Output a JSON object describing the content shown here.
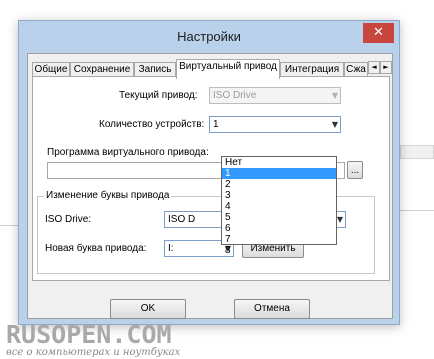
{
  "window": {
    "title": "Настройки",
    "close_glyph": "✕"
  },
  "tabs": [
    {
      "label": "Общие",
      "active": false
    },
    {
      "label": "Сохранение",
      "active": false
    },
    {
      "label": "Запись",
      "active": false
    },
    {
      "label": "Виртуальный привод",
      "active": true
    },
    {
      "label": "Интеграция",
      "active": false
    },
    {
      "label": "Сжа",
      "active": false
    }
  ],
  "tab_scroll": {
    "left": "◄",
    "right": "►"
  },
  "form": {
    "current_drive_label": "Текущий привод:",
    "current_drive_value": "ISO Drive",
    "device_count_label": "Количество устройств:",
    "device_count_value": "1",
    "program_label": "Программа виртуального привода:",
    "program_value": "",
    "browse_label": "...",
    "combo_arrow": "▼"
  },
  "dropdown": {
    "options": [
      "Нет",
      "1",
      "2",
      "3",
      "4",
      "5",
      "6",
      "7",
      "8"
    ],
    "selected_index": 1
  },
  "group": {
    "title": "Изменение буквы привода",
    "iso_drive_label": "ISO Drive:",
    "iso_drive_value": "ISO D",
    "new_letter_label": "Новая буква привода:",
    "new_letter_value": "I:",
    "change_button": "Изменить"
  },
  "buttons": {
    "ok": "OK",
    "cancel": "Отмена"
  },
  "watermark": {
    "main": "RUSOPEN.COM",
    "sub": "все о компьютерах и ноутбуках"
  },
  "colors": {
    "titlebar": "#b9d1ea",
    "close_button": "#c7463d",
    "selection": "#3399ff"
  }
}
